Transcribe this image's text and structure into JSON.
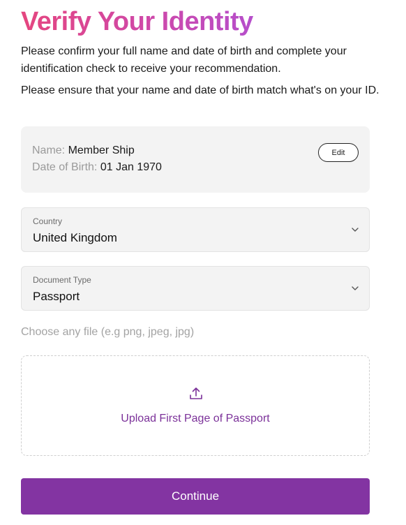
{
  "header": {
    "title": "Verify Your Identity",
    "intro": "Please confirm your full name and date of birth and complete your identification check to receive your recommendation.",
    "notice": "Please ensure that your name and date of birth match what's on your ID."
  },
  "profile": {
    "name_label": "Name:",
    "name_value": "Member Ship",
    "dob_label": "Date of Birth:",
    "dob_value": "01 Jan 1970",
    "edit_label": "Edit"
  },
  "country": {
    "label": "Country",
    "value": "United Kingdom",
    "icon": "chevron-down-icon"
  },
  "document_type": {
    "label": "Document Type",
    "value": "Passport",
    "icon": "chevron-down-icon"
  },
  "upload": {
    "hint": "Choose any file (e.g png, jpeg, jpg)",
    "icon": "upload-icon",
    "label": "Upload First Page of Passport"
  },
  "actions": {
    "continue_label": "Continue"
  },
  "colors": {
    "title_gradient_start": "#e5467f",
    "title_gradient_end": "#b64ecb",
    "accent": "#8334a2",
    "upload_text": "#7b3199"
  }
}
